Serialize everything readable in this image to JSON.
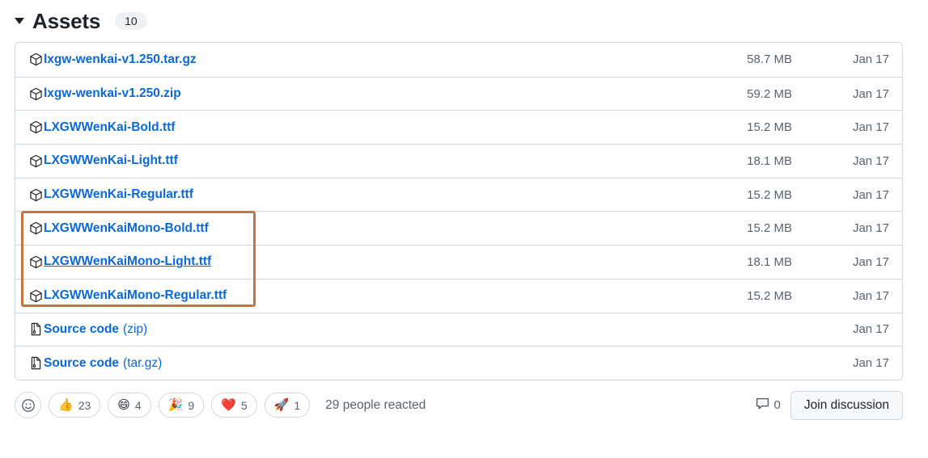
{
  "header": {
    "title": "Assets",
    "count": "10",
    "toggle_icon": "chevron-down-triangle-icon"
  },
  "assets": {
    "rows": [
      {
        "icon": "package-icon",
        "name": "lxgw-wenkai-v1.250.tar.gz",
        "suffix": "",
        "size": "58.7 MB",
        "date": "Jan 17",
        "hovered": false
      },
      {
        "icon": "package-icon",
        "name": "lxgw-wenkai-v1.250.zip",
        "suffix": "",
        "size": "59.2 MB",
        "date": "Jan 17",
        "hovered": false
      },
      {
        "icon": "package-icon",
        "name": "LXGWWenKai-Bold.ttf",
        "suffix": "",
        "size": "15.2 MB",
        "date": "Jan 17",
        "hovered": false
      },
      {
        "icon": "package-icon",
        "name": "LXGWWenKai-Light.ttf",
        "suffix": "",
        "size": "18.1 MB",
        "date": "Jan 17",
        "hovered": false
      },
      {
        "icon": "package-icon",
        "name": "LXGWWenKai-Regular.ttf",
        "suffix": "",
        "size": "15.2 MB",
        "date": "Jan 17",
        "hovered": false
      },
      {
        "icon": "package-icon",
        "name": "LXGWWenKaiMono-Bold.ttf",
        "suffix": "",
        "size": "15.2 MB",
        "date": "Jan 17",
        "hovered": false
      },
      {
        "icon": "package-icon",
        "name": "LXGWWenKaiMono-Light.ttf",
        "suffix": "",
        "size": "18.1 MB",
        "date": "Jan 17",
        "hovered": true
      },
      {
        "icon": "package-icon",
        "name": "LXGWWenKaiMono-Regular.ttf",
        "suffix": "",
        "size": "15.2 MB",
        "date": "Jan 17",
        "hovered": false
      },
      {
        "icon": "file-zip-icon",
        "name": "Source code",
        "suffix": "(zip)",
        "size": "",
        "date": "Jan 17",
        "hovered": false
      },
      {
        "icon": "file-zip-icon",
        "name": "Source code",
        "suffix": "(tar.gz)",
        "size": "",
        "date": "Jan 17",
        "hovered": false
      }
    ]
  },
  "highlight": {
    "color": "#bf7748",
    "label": "annotation-highlight-mono-fonts"
  },
  "footer": {
    "add_reaction_icon": "smiley-plus-icon",
    "reactions": [
      {
        "emoji": "👍",
        "name": "thumbs-up",
        "count": "23"
      },
      {
        "emoji": "😄",
        "name": "laugh",
        "count": "4"
      },
      {
        "emoji": "🎉",
        "name": "hooray",
        "count": "9"
      },
      {
        "emoji": "❤️",
        "name": "heart",
        "count": "5"
      },
      {
        "emoji": "🚀",
        "name": "rocket",
        "count": "1"
      }
    ],
    "reacted_text": "29 people reacted",
    "comment_icon": "comment-icon",
    "comment_count": "0",
    "join_label": "Join discussion"
  }
}
